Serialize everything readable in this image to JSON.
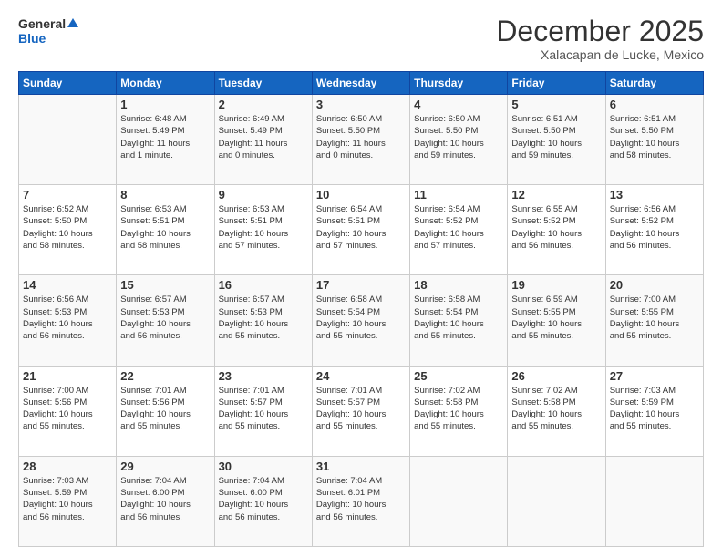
{
  "header": {
    "logo_general": "General",
    "logo_blue": "Blue",
    "month_title": "December 2025",
    "location": "Xalacapan de Lucke, Mexico"
  },
  "days_of_week": [
    "Sunday",
    "Monday",
    "Tuesday",
    "Wednesday",
    "Thursday",
    "Friday",
    "Saturday"
  ],
  "weeks": [
    [
      {
        "day": "",
        "info": ""
      },
      {
        "day": "1",
        "info": "Sunrise: 6:48 AM\nSunset: 5:49 PM\nDaylight: 11 hours\nand 1 minute."
      },
      {
        "day": "2",
        "info": "Sunrise: 6:49 AM\nSunset: 5:49 PM\nDaylight: 11 hours\nand 0 minutes."
      },
      {
        "day": "3",
        "info": "Sunrise: 6:50 AM\nSunset: 5:50 PM\nDaylight: 11 hours\nand 0 minutes."
      },
      {
        "day": "4",
        "info": "Sunrise: 6:50 AM\nSunset: 5:50 PM\nDaylight: 10 hours\nand 59 minutes."
      },
      {
        "day": "5",
        "info": "Sunrise: 6:51 AM\nSunset: 5:50 PM\nDaylight: 10 hours\nand 59 minutes."
      },
      {
        "day": "6",
        "info": "Sunrise: 6:51 AM\nSunset: 5:50 PM\nDaylight: 10 hours\nand 58 minutes."
      }
    ],
    [
      {
        "day": "7",
        "info": "Sunrise: 6:52 AM\nSunset: 5:50 PM\nDaylight: 10 hours\nand 58 minutes."
      },
      {
        "day": "8",
        "info": "Sunrise: 6:53 AM\nSunset: 5:51 PM\nDaylight: 10 hours\nand 58 minutes."
      },
      {
        "day": "9",
        "info": "Sunrise: 6:53 AM\nSunset: 5:51 PM\nDaylight: 10 hours\nand 57 minutes."
      },
      {
        "day": "10",
        "info": "Sunrise: 6:54 AM\nSunset: 5:51 PM\nDaylight: 10 hours\nand 57 minutes."
      },
      {
        "day": "11",
        "info": "Sunrise: 6:54 AM\nSunset: 5:52 PM\nDaylight: 10 hours\nand 57 minutes."
      },
      {
        "day": "12",
        "info": "Sunrise: 6:55 AM\nSunset: 5:52 PM\nDaylight: 10 hours\nand 56 minutes."
      },
      {
        "day": "13",
        "info": "Sunrise: 6:56 AM\nSunset: 5:52 PM\nDaylight: 10 hours\nand 56 minutes."
      }
    ],
    [
      {
        "day": "14",
        "info": "Sunrise: 6:56 AM\nSunset: 5:53 PM\nDaylight: 10 hours\nand 56 minutes."
      },
      {
        "day": "15",
        "info": "Sunrise: 6:57 AM\nSunset: 5:53 PM\nDaylight: 10 hours\nand 56 minutes."
      },
      {
        "day": "16",
        "info": "Sunrise: 6:57 AM\nSunset: 5:53 PM\nDaylight: 10 hours\nand 55 minutes."
      },
      {
        "day": "17",
        "info": "Sunrise: 6:58 AM\nSunset: 5:54 PM\nDaylight: 10 hours\nand 55 minutes."
      },
      {
        "day": "18",
        "info": "Sunrise: 6:58 AM\nSunset: 5:54 PM\nDaylight: 10 hours\nand 55 minutes."
      },
      {
        "day": "19",
        "info": "Sunrise: 6:59 AM\nSunset: 5:55 PM\nDaylight: 10 hours\nand 55 minutes."
      },
      {
        "day": "20",
        "info": "Sunrise: 7:00 AM\nSunset: 5:55 PM\nDaylight: 10 hours\nand 55 minutes."
      }
    ],
    [
      {
        "day": "21",
        "info": "Sunrise: 7:00 AM\nSunset: 5:56 PM\nDaylight: 10 hours\nand 55 minutes."
      },
      {
        "day": "22",
        "info": "Sunrise: 7:01 AM\nSunset: 5:56 PM\nDaylight: 10 hours\nand 55 minutes."
      },
      {
        "day": "23",
        "info": "Sunrise: 7:01 AM\nSunset: 5:57 PM\nDaylight: 10 hours\nand 55 minutes."
      },
      {
        "day": "24",
        "info": "Sunrise: 7:01 AM\nSunset: 5:57 PM\nDaylight: 10 hours\nand 55 minutes."
      },
      {
        "day": "25",
        "info": "Sunrise: 7:02 AM\nSunset: 5:58 PM\nDaylight: 10 hours\nand 55 minutes."
      },
      {
        "day": "26",
        "info": "Sunrise: 7:02 AM\nSunset: 5:58 PM\nDaylight: 10 hours\nand 55 minutes."
      },
      {
        "day": "27",
        "info": "Sunrise: 7:03 AM\nSunset: 5:59 PM\nDaylight: 10 hours\nand 55 minutes."
      }
    ],
    [
      {
        "day": "28",
        "info": "Sunrise: 7:03 AM\nSunset: 5:59 PM\nDaylight: 10 hours\nand 56 minutes."
      },
      {
        "day": "29",
        "info": "Sunrise: 7:04 AM\nSunset: 6:00 PM\nDaylight: 10 hours\nand 56 minutes."
      },
      {
        "day": "30",
        "info": "Sunrise: 7:04 AM\nSunset: 6:00 PM\nDaylight: 10 hours\nand 56 minutes."
      },
      {
        "day": "31",
        "info": "Sunrise: 7:04 AM\nSunset: 6:01 PM\nDaylight: 10 hours\nand 56 minutes."
      },
      {
        "day": "",
        "info": ""
      },
      {
        "day": "",
        "info": ""
      },
      {
        "day": "",
        "info": ""
      }
    ]
  ]
}
